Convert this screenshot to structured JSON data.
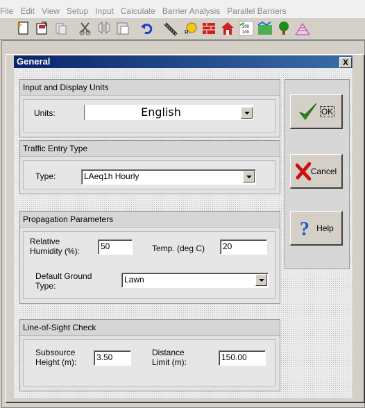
{
  "menu": [
    "File",
    "Edit",
    "View",
    "Setup",
    "Input",
    "Calculate",
    "Barrier Analysis",
    "Parallel Barriers"
  ],
  "toolbar_icons": [
    "new-icon",
    "open-icon",
    "print-icon",
    "cut-icon",
    "copy-icon",
    "paste-icon",
    "undo-icon",
    "road-icon",
    "receiver-icon",
    "barrier-icon",
    "building-icon",
    "terrain-icon",
    "ground-zone-icon",
    "tree-zone-icon",
    "contour-icon"
  ],
  "toolbar_scale": {
    "top": "200",
    "bottom": "100"
  },
  "dialog": {
    "title": "General",
    "close_glyph": "X"
  },
  "units_group": {
    "title": "Input and Display Units",
    "label": "Units:",
    "value": "English"
  },
  "traffic_group": {
    "title": "Traffic Entry Type",
    "label": "Type:",
    "value": "LAeq1h Hourly"
  },
  "propagation_group": {
    "title": "Propagation Parameters",
    "humidity_label_1": "Relative",
    "humidity_label_2": "Humidity (%):",
    "humidity_value": "50",
    "temp_label": "Temp. (deg C)",
    "temp_value": "20",
    "ground_label_1": "Default Ground",
    "ground_label_2": "Type:",
    "ground_value": "Lawn"
  },
  "los_group": {
    "title": "Line-of-Sight Check",
    "subsource_label_1": "Subsource",
    "subsource_label_2": "Height (m):",
    "subsource_value": "3.50",
    "distance_label_1": "Distance",
    "distance_label_2": "Limit (m):",
    "distance_value": "150.00"
  },
  "buttons": {
    "ok": "OK",
    "cancel": "Cancel",
    "help": "Help"
  },
  "colors": {
    "titlebar": "#0a246a",
    "ok_check": "#2e8b1e",
    "cancel_x": "#cc1111",
    "help_q": "#1e5bd6"
  }
}
